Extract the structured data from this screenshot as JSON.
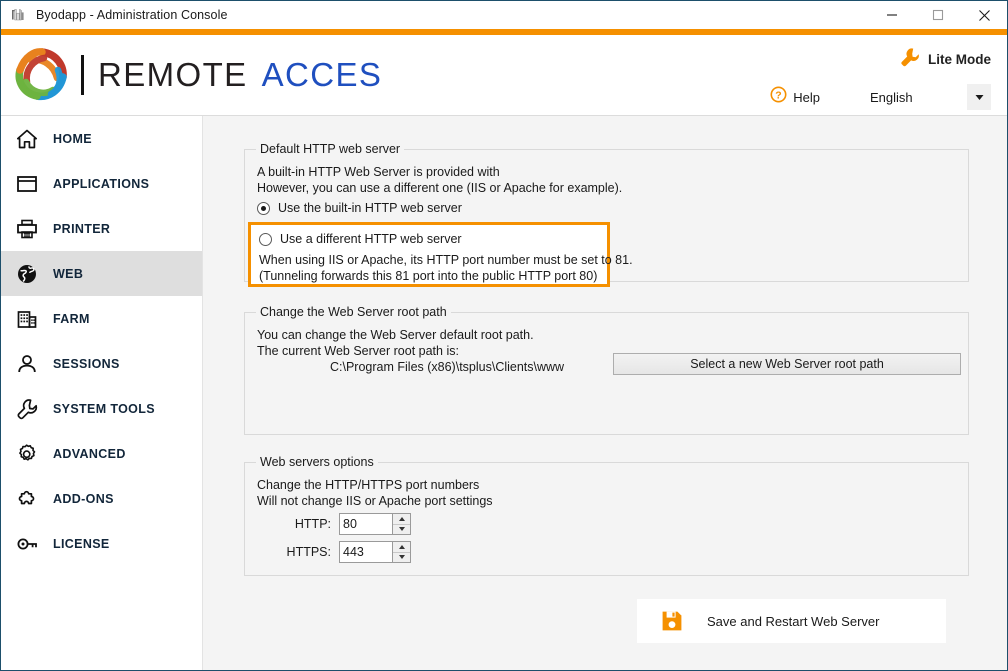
{
  "window": {
    "title": "Byodapp - Administration Console",
    "icon": "tools-icon",
    "controls": {
      "minimize": "minimize-icon",
      "maximize": "maximize-icon",
      "close": "close-icon"
    },
    "accent_color": "#f59000",
    "border_color": "#1d4f6b"
  },
  "header": {
    "brand_word1": "REMOTE",
    "brand_word2": "ACCES",
    "brand_word1_color": "#231f20",
    "brand_word2_color": "#1f4fbf",
    "lite_mode": {
      "label": "Lite Mode",
      "icon": "wrench-icon"
    },
    "help": {
      "label": "Help",
      "icon": "question-circle-icon"
    },
    "language": {
      "value": "English",
      "options": [
        "English"
      ]
    }
  },
  "sidebar": {
    "items": [
      {
        "label": "HOME",
        "icon": "home-icon",
        "selected": false
      },
      {
        "label": "APPLICATIONS",
        "icon": "window-icon",
        "selected": false
      },
      {
        "label": "PRINTER",
        "icon": "printer-icon",
        "selected": false
      },
      {
        "label": "WEB",
        "icon": "globe-icon",
        "selected": true
      },
      {
        "label": "FARM",
        "icon": "building-icon",
        "selected": false
      },
      {
        "label": "SESSIONS",
        "icon": "user-icon",
        "selected": false
      },
      {
        "label": "SYSTEM TOOLS",
        "icon": "wrench-icon",
        "selected": false
      },
      {
        "label": "ADVANCED",
        "icon": "gear-icon",
        "selected": false
      },
      {
        "label": "ADD-ONS",
        "icon": "puzzle-icon",
        "selected": false
      },
      {
        "label": "LICENSE",
        "icon": "key-icon",
        "selected": false
      }
    ]
  },
  "main": {
    "default_server": {
      "title": "Default HTTP web server",
      "desc_line1": "A built-in HTTP Web Server is provided with",
      "desc_line2": "However, you can use a different one (IIS or Apache for example).",
      "option_builtin": {
        "label": "Use the built-in HTTP web server",
        "checked": true
      },
      "option_different": {
        "label": "Use a different HTTP web server",
        "checked": false
      },
      "note_line1": "When using IIS or Apache, its HTTP port number must be set to 81.",
      "note_line2": "(Tunneling forwards this 81 port into the public HTTP port 80)",
      "highlight_color": "#f59000"
    },
    "root_path": {
      "title": "Change the Web Server root path",
      "desc_line1": "You can change the Web Server default root path.",
      "desc_line2": "The current Web Server root path is:",
      "current_path": "C:\\Program Files (x86)\\tsplus\\Clients\\www",
      "button_label": "Select a new Web Server root path"
    },
    "web_options": {
      "title": "Web servers options",
      "desc_line1": "Change the HTTP/HTTPS port numbers",
      "desc_line2": "Will not change IIS or Apache port settings",
      "http_label": "HTTP:",
      "http_value": "80",
      "https_label": "HTTPS:",
      "https_value": "443"
    },
    "save_button": {
      "label": "Save and Restart Web Server",
      "icon": "save-disk-icon"
    }
  }
}
